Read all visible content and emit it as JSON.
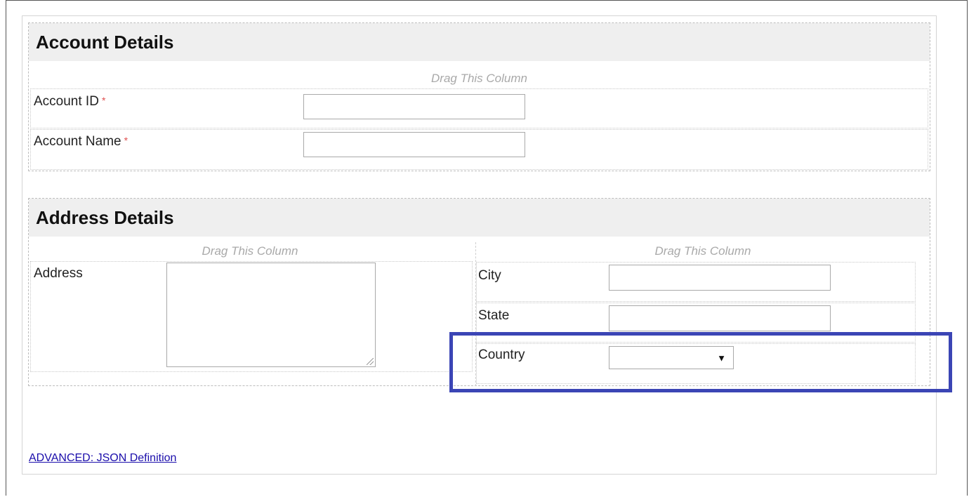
{
  "account_section": {
    "title": "Account Details",
    "drag_hint": "Drag This Column",
    "fields": [
      {
        "label": "Account ID",
        "required_mark": "*",
        "value": ""
      },
      {
        "label": "Account Name",
        "required_mark": "*",
        "value": ""
      }
    ]
  },
  "address_section": {
    "title": "Address Details",
    "left_column": {
      "drag_hint": "Drag This Column",
      "address_label": "Address",
      "address_value": ""
    },
    "right_column": {
      "drag_hint": "Drag This Column",
      "city_label": "City",
      "city_value": "",
      "state_label": "State",
      "state_value": "",
      "country_label": "Country",
      "country_selected": "",
      "country_arrow": "▼"
    }
  },
  "highlight_color": "#3b45b5",
  "advanced_link": "ADVANCED: JSON Definition"
}
